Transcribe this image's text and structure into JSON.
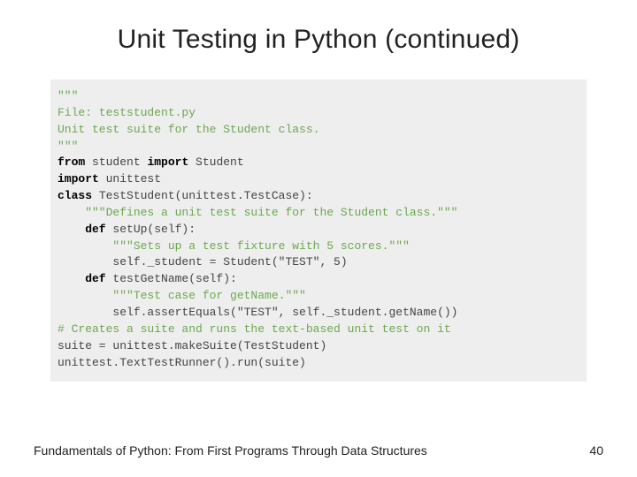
{
  "title": "Unit Testing in Python (continued)",
  "code": {
    "l1": "\"\"\"",
    "l2": "File: teststudent.py",
    "l3": "Unit test suite for the Student class.",
    "l4": "\"\"\"",
    "l5": "",
    "l6a": "from",
    "l6b": " student ",
    "l6c": "import",
    "l6d": " Student",
    "l7a": "import",
    "l7b": " unittest",
    "l8": "",
    "l9a": "class",
    "l9b": " TestStudent(unittest.TestCase):",
    "l10": "    \"\"\"Defines a unit test suite for the Student class.\"\"\"",
    "l11": "",
    "l12a": "    def",
    "l12b": " setUp(self):",
    "l13": "        \"\"\"Sets up a test fixture with 5 scores.\"\"\"",
    "l14": "        self._student = Student(\"TEST\", 5)",
    "l15": "",
    "l16a": "    def",
    "l16b": " testGetName(self):",
    "l17": "        \"\"\"Test case for getName.\"\"\"",
    "l18": "        self.assertEquals(\"TEST\", self._student.getName())",
    "l19": "",
    "l20": "# Creates a suite and runs the text-based unit test on it",
    "l21": "suite = unittest.makeSuite(TestStudent)",
    "l22": "unittest.TextTestRunner().run(suite)"
  },
  "footer": {
    "text": "Fundamentals of Python: From First Programs Through Data Structures",
    "page": "40"
  }
}
